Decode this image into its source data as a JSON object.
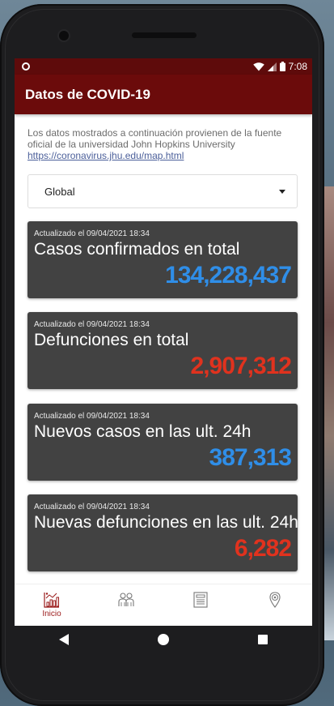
{
  "status_bar": {
    "time": "7:08"
  },
  "app_bar": {
    "title": "Datos de COVID-19"
  },
  "source": {
    "text": "Los datos mostrados a continuación provienen de la fuente oficial de la universidad John Hopkins University",
    "link": "https://coronavirus.jhu.edu/map.html"
  },
  "region_select": {
    "value": "Global"
  },
  "cards": [
    {
      "updated": "Actualizado el 09/04/2021 18:34",
      "title": "Casos confirmados en total",
      "value": "134,228,437",
      "color": "#2f8ee8"
    },
    {
      "updated": "Actualizado el 09/04/2021 18:34",
      "title": "Defunciones en total",
      "value": "2,907,312",
      "color": "#e0321e"
    },
    {
      "updated": "Actualizado el 09/04/2021 18:34",
      "title": "Nuevos casos en las ult. 24h",
      "value": "387,313",
      "color": "#2f8ee8"
    },
    {
      "updated": "Actualizado el 09/04/2021 18:34",
      "title": "Nuevas defunciones en las ult. 24h",
      "value": "6,282",
      "color": "#e0321e"
    }
  ],
  "bottom_nav": [
    {
      "icon": "chart-icon",
      "label": "Inicio",
      "active": true
    },
    {
      "icon": "people-icon",
      "label": ""
    },
    {
      "icon": "news-icon",
      "label": ""
    },
    {
      "icon": "location-icon",
      "label": ""
    }
  ],
  "colors": {
    "app_bar": "#6b0b0b",
    "status_bar": "#5e0b0b",
    "card": "#424242",
    "accent_blue": "#2f8ee8",
    "accent_red": "#e0321e",
    "nav_active": "#9a1a1a"
  }
}
